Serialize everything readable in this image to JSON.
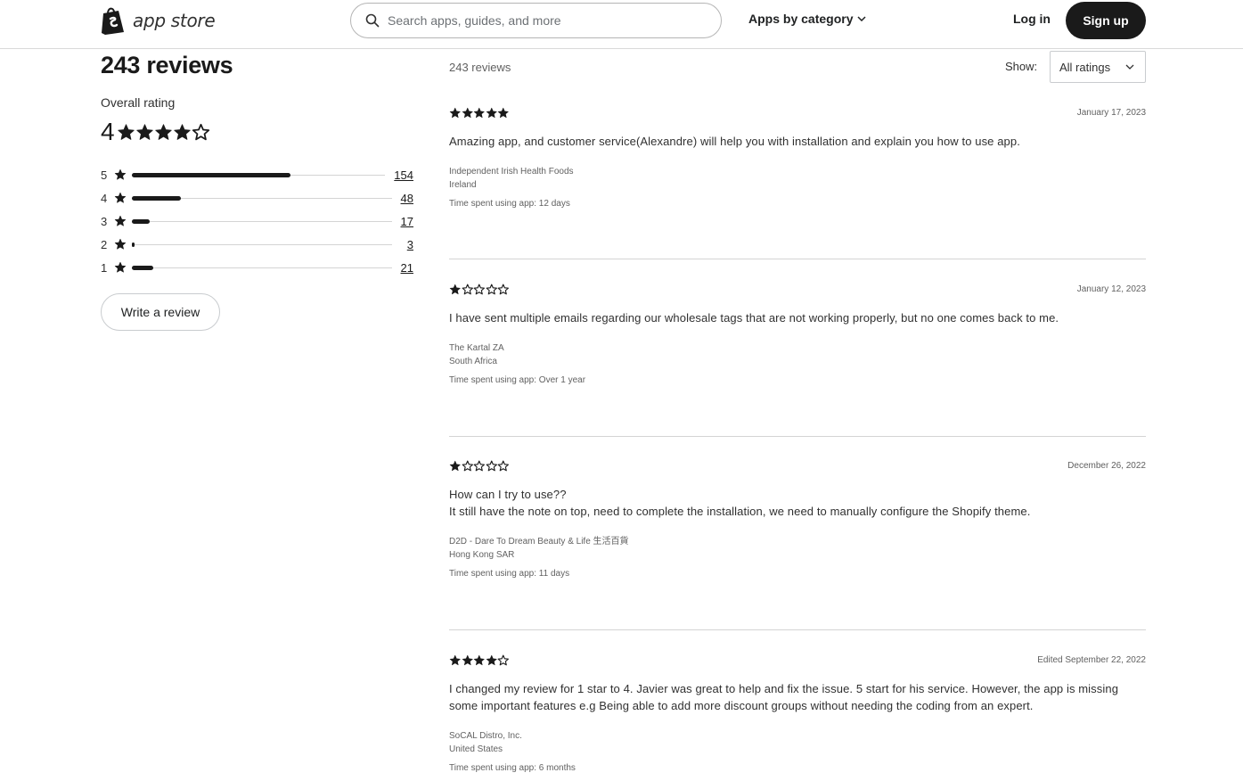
{
  "header": {
    "logo_text": "app store",
    "search_placeholder": "Search apps, guides, and more",
    "category_label": "Apps by category",
    "login_label": "Log in",
    "signup_label": "Sign up"
  },
  "summary": {
    "title": "243 reviews",
    "overall_label": "Overall rating",
    "overall_value": "4",
    "overall_stars": 4,
    "distribution": [
      {
        "stars": "5",
        "count": "154",
        "fraction": 0.634
      },
      {
        "stars": "4",
        "count": "48",
        "fraction": 0.198
      },
      {
        "stars": "3",
        "count": "17",
        "fraction": 0.07
      },
      {
        "stars": "2",
        "count": "3",
        "fraction": 0.012
      },
      {
        "stars": "1",
        "count": "21",
        "fraction": 0.086
      }
    ],
    "write_review_label": "Write a review"
  },
  "list": {
    "count_label": "243 reviews",
    "show_label": "Show:",
    "filter_value": "All ratings"
  },
  "reviews": [
    {
      "rating": 5,
      "date": "January 17, 2023",
      "body": [
        "Amazing app, and customer service(Alexandre) will help you with installation and explain you how to use app."
      ],
      "shop": "Independent Irish Health Foods",
      "location": "Ireland",
      "time_spent": "Time spent using app: 12 days"
    },
    {
      "rating": 1,
      "date": "January 12, 2023",
      "body": [
        "I have sent multiple emails regarding our wholesale tags that are not working properly, but no one comes back to me."
      ],
      "shop": "The Kartal ZA",
      "location": "South Africa",
      "time_spent": "Time spent using app: Over 1 year"
    },
    {
      "rating": 1,
      "date": "December 26, 2022",
      "body": [
        "How can I try to use??",
        "It still have the note on top, need to complete the installation, we need to manually configure the Shopify theme."
      ],
      "shop": "D2D - Dare To Dream Beauty & Life 生活百貨",
      "location": "Hong Kong SAR",
      "time_spent": "Time spent using app: 11 days"
    },
    {
      "rating": 4,
      "date": "Edited September 22, 2022",
      "body": [
        "I changed my review for 1 star to 4. Javier was great to help and fix the issue. 5 start for his service. However, the app is missing some important features e.g Being able to add more discount groups without needing the coding from an expert."
      ],
      "shop": "SoCAL Distro, Inc.",
      "location": "United States",
      "time_spent": "Time spent using app: 6 months"
    }
  ]
}
